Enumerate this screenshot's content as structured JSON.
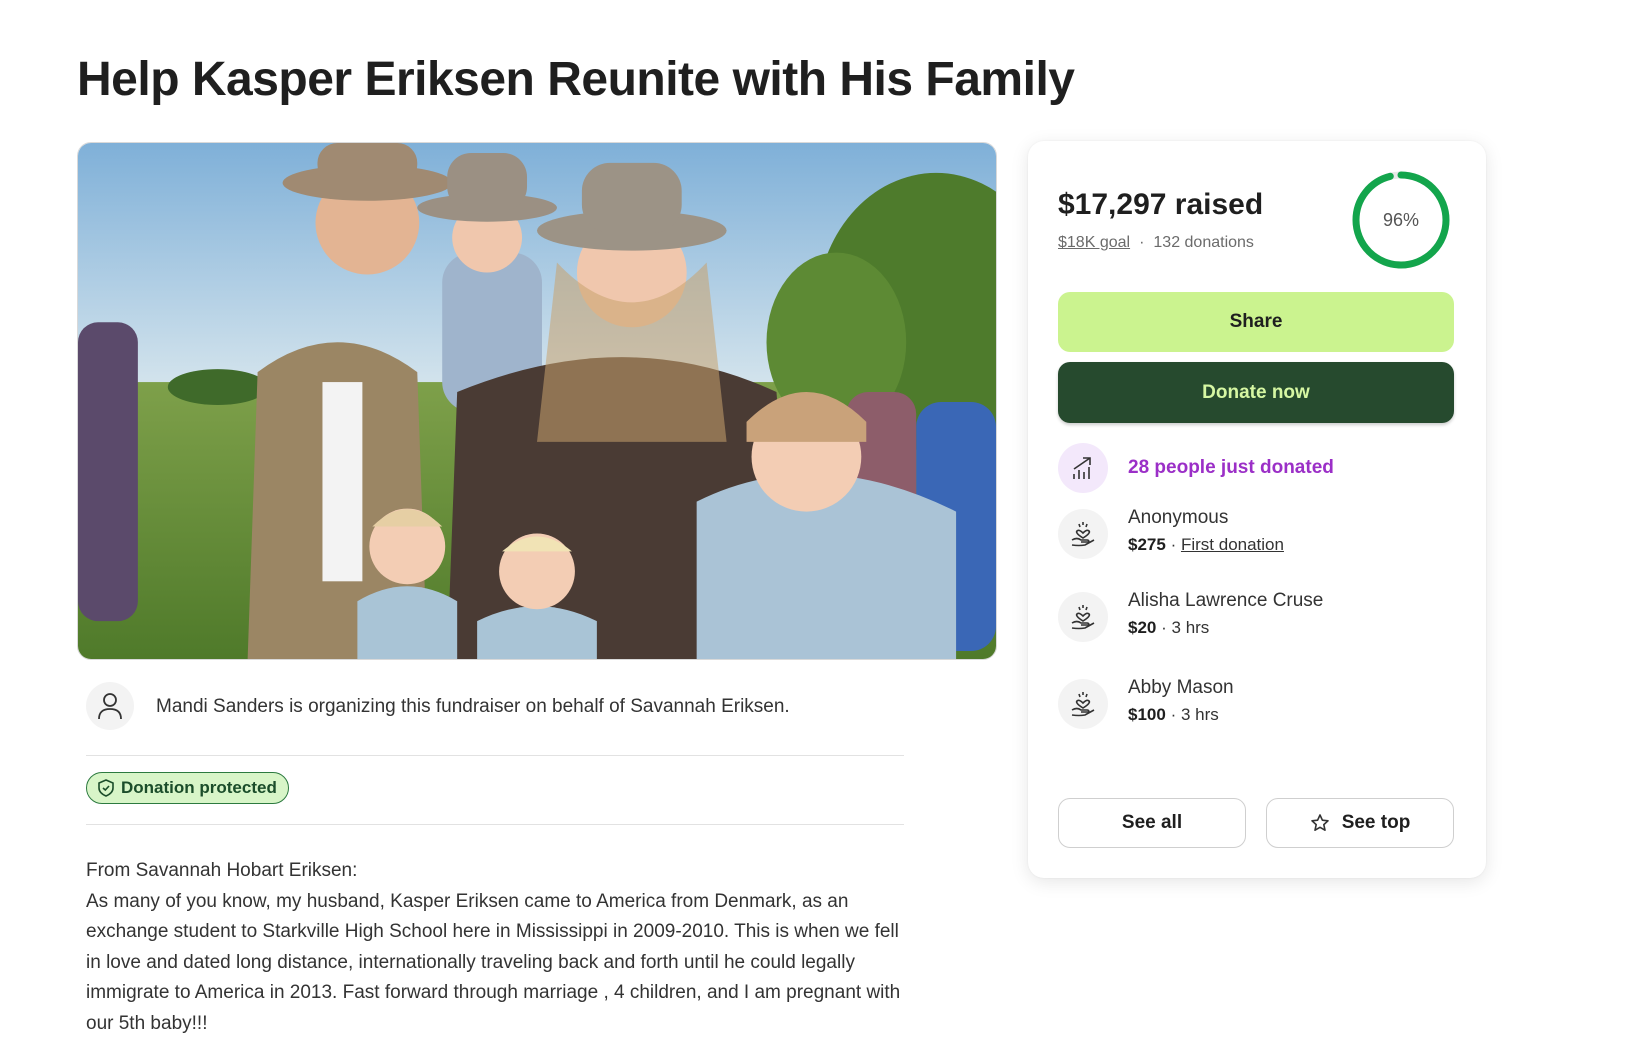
{
  "page": {
    "title": "Help Kasper Eriksen Reunite with His Family"
  },
  "organizer": {
    "text": "Mandi Sanders is organizing this fundraiser on behalf of Savannah Eriksen."
  },
  "badge": {
    "label": "Donation protected"
  },
  "story": {
    "intro": "From Savannah Hobart Eriksen:",
    "body": "As many of you know, my husband, Kasper Eriksen came to America from Denmark, as an exchange student to Starkville High School here in Mississippi in 2009-2010. This is when we fell in love and dated long distance, internationally traveling back and forth until he could legally immigrate to America in 2013. Fast forward through marriage , 4 children, and I am pregnant with our 5th baby!!!"
  },
  "card": {
    "raised": "$17,297 raised",
    "goal": "$18K goal",
    "separator": "·",
    "donations": "132 donations",
    "progress_percent": 96,
    "progress_label": "96%",
    "share_label": "Share",
    "donate_label": "Donate now",
    "activity_label": "28 people just donated",
    "donors": [
      {
        "name": "Anonymous",
        "amount": "$275",
        "sep": "·",
        "note": "First donation"
      },
      {
        "name": "Alisha Lawrence Cruse",
        "amount": "$20",
        "sep": "·",
        "note": "3 hrs"
      },
      {
        "name": "Abby Mason",
        "amount": "$100",
        "sep": "·",
        "note": "3 hrs"
      }
    ],
    "see_all_label": "See all",
    "see_top_label": "See top"
  },
  "colors": {
    "share_bg": "#cbf38f",
    "donate_bg": "#264a2e",
    "progress": "#13a54c",
    "activity": "#9b2fc7",
    "badge_bg": "#d8f5c8"
  },
  "icons": {
    "organizer": "person-icon",
    "badge": "shield-icon",
    "activity": "trending-up-icon",
    "donor": "heart-hand-icon",
    "see_top": "star-icon"
  }
}
